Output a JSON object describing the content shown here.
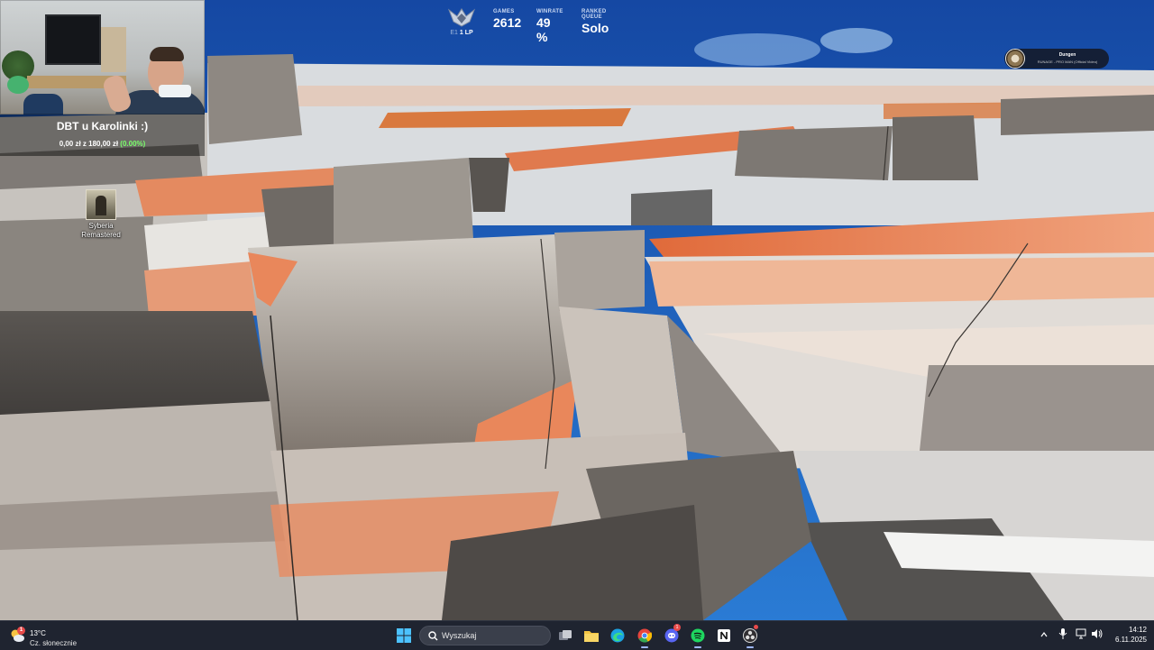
{
  "overlay": {
    "donation": {
      "title": "DBT u Karolinki :)",
      "amount_main": "0,00 zł z 180,00 zł",
      "amount_percent": "(0.00%)"
    },
    "lol_stats": {
      "lp_prefix": "E1",
      "lp_value": "1 LP",
      "games_label": "GAMES",
      "games_value": "2612",
      "winrate_label": "WINRATE",
      "winrate_value": "49 %",
      "queue_label": "RANKED QUEUE",
      "queue_value": "Solo"
    },
    "now_playing": {
      "title": "Dungen",
      "subtitle": "RUNAGE - PRO MAN (Official Video)"
    }
  },
  "desktop": {
    "icons": [
      {
        "label": "Syberia Remastered",
        "icon": "game-shortcut-icon"
      }
    ]
  },
  "taskbar": {
    "weather": {
      "temp": "13°C",
      "condition": "Cz. słonecznie",
      "badge": "1"
    },
    "search_placeholder": "Wyszukaj",
    "apps": [
      "start",
      "search",
      "task-view",
      "file-explorer",
      "edge",
      "chrome",
      "discord",
      "spotify",
      "notion",
      "obs"
    ],
    "discord_badge": "1",
    "clock": {
      "time": "14:12",
      "date": "6.11.2025"
    }
  },
  "colors": {
    "taskbar_bg": "#1f2430",
    "sky": "#1b4f9a",
    "accent_orange": "#e07a4e",
    "progress_green": "#7aff6b"
  }
}
